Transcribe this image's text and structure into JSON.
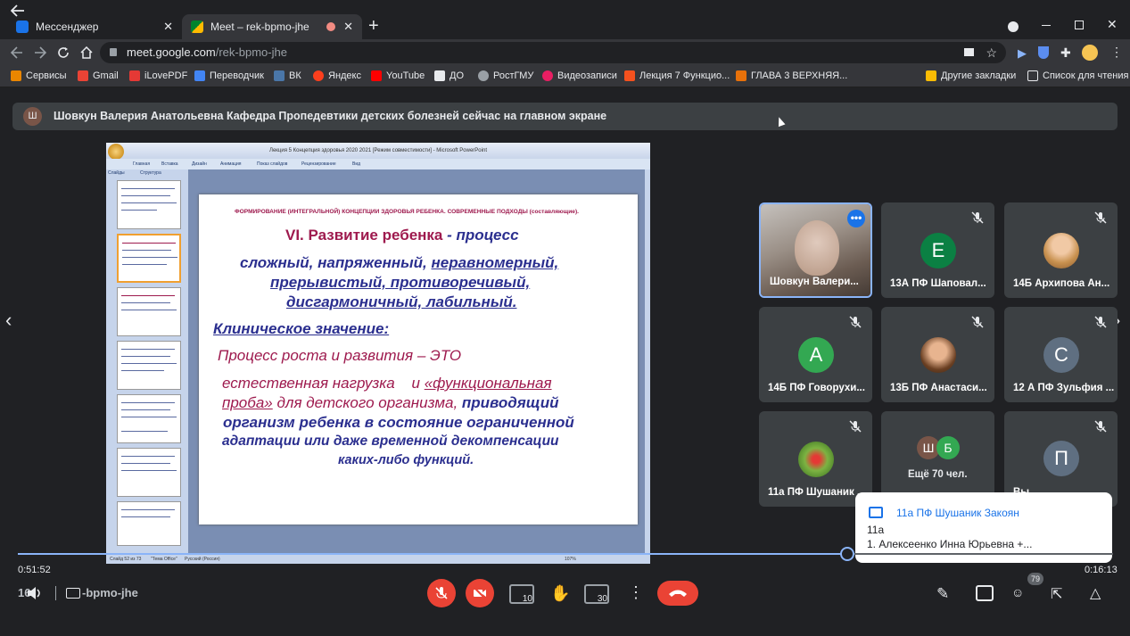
{
  "browser": {
    "tabs": [
      {
        "label": "Мессенджер",
        "active": false
      },
      {
        "label": "Meet – rek-bpmo-jhe",
        "active": true
      }
    ],
    "new_tab": "+",
    "url_host": "meet.google.com",
    "url_path": "/rek-bpmo-jhe",
    "bookmarks": [
      "Сервисы",
      "Gmail",
      "iLovePDF",
      "Переводчик",
      "ВК",
      "Яндекс",
      "YouTube",
      "ДО",
      "РостГМУ",
      "Видеозаписи",
      "Лекция 7 Функцио...",
      "ГЛАВА 3 ВЕРХНЯЯ...",
      "Другие закладки",
      "Список для чтения"
    ]
  },
  "banner": {
    "avatar_letter": "Ш",
    "text": "Шовкун Валерия Анатольевна Кафедра Пропедевтики детских болезней сейчас на главном экране"
  },
  "slide": {
    "app_title": "Лекция 5 Концепция здоровья 2020 2021 [Режим совместимости] - Microsoft PowerPoint",
    "ribbon_tabs": [
      "Главная",
      "Вставка",
      "Дизайн",
      "Анимация",
      "Показ слайдов",
      "Рецензирование",
      "Вид"
    ],
    "panel_tabs": [
      "Слайды",
      "Структура"
    ],
    "status": [
      "Слайд 52 из 73",
      "\"Тема Office\"",
      "Русский (Россия)",
      "107%"
    ],
    "header": "ФОРМИРОВАНИЕ (ИНТЕГРАЛЬНОЙ) КОНЦЕПЦИИ ЗДОРОВЬЯ РЕБЕНКА. СОВРЕМЕННЫЕ ПОДХОДЫ (составляющие).",
    "heading_a": "VI. Развитие ребенка",
    "heading_b": "- процесс",
    "line1_a": "сложный, напряженный,",
    "line1_b": "неравномерный,",
    "line2": "прерывистый,  противоречивый,",
    "line3": "дисгармоничный,  лабильный.",
    "clinical": "Клиническое значение:",
    "growth": "Процесс роста и развития – ЭТО",
    "p1_a": "естественная нагрузка",
    "p1_b": "и",
    "p1_c": "«функциональная",
    "p2_a": "проба»",
    "p2_b": "для детского организма,",
    "p2_c": "приводящий",
    "p3": "организм ребенка в состояние ограниченной",
    "p4": "адаптации или даже временной декомпенсации",
    "p5": "каких-либо функций."
  },
  "participants": [
    {
      "name": "Шовкун Валери...",
      "type": "video",
      "speaking": true
    },
    {
      "name": "13А ПФ Шаповал...",
      "letter": "Е",
      "color": "#0b8043"
    },
    {
      "name": "14Б Архипова Ан...",
      "type": "photo"
    },
    {
      "name": "14Б ПФ Говорухи...",
      "letter": "А",
      "color": "#33a852"
    },
    {
      "name": "13Б ПФ Анастаси...",
      "type": "photo"
    },
    {
      "name": "12 А ПФ Зульфия ...",
      "letter": "С",
      "color": "#5f6f81"
    },
    {
      "name": "11а ПФ Шушаник ...",
      "type": "photo"
    },
    {
      "name": "Ещё 70 чел.",
      "letters": [
        "Ш",
        "Б"
      ]
    },
    {
      "name": "Вы",
      "letter": "П",
      "color": "#5f6f81"
    }
  ],
  "chat_popup": {
    "sender": "11а ПФ Шушаник Закоян",
    "line1": "11а",
    "line2": "1. Алексеенко Инна Юрьевна +..."
  },
  "player": {
    "current": "0:51:52",
    "total": "0:16:13",
    "progress": 0.757,
    "meeting_code": "-bpmo-jhe",
    "time_prefix": "16:",
    "people_count": "79"
  }
}
